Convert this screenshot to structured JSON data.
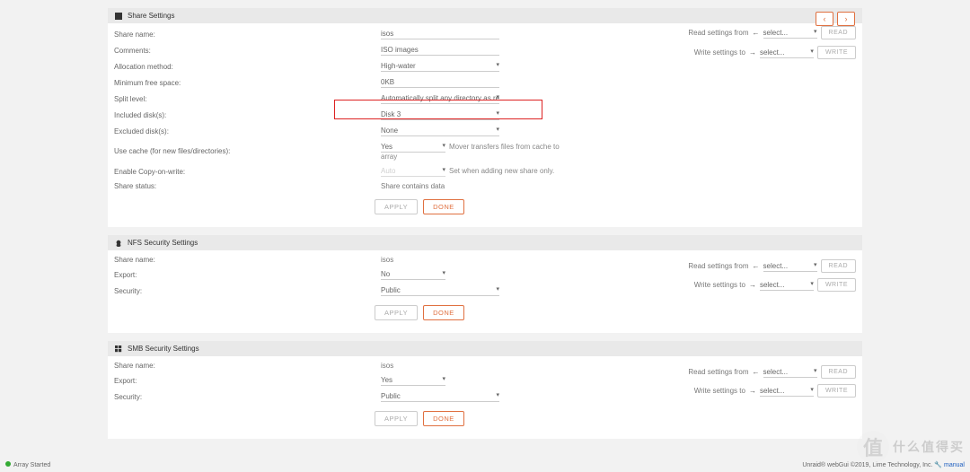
{
  "share": {
    "title": "Share Settings",
    "nav": {
      "prev": "‹",
      "next": "›"
    },
    "rows": {
      "name_label": "Share name:",
      "name_value": "isos",
      "comments_label": "Comments:",
      "comments_value": "ISO images",
      "alloc_label": "Allocation method:",
      "alloc_value": "High-water",
      "minfree_label": "Minimum free space:",
      "minfree_value": "0KB",
      "split_label": "Split level:",
      "split_value": "Automatically split any directory as required",
      "included_label": "Included disk(s):",
      "included_value": "Disk 3",
      "excluded_label": "Excluded disk(s):",
      "excluded_value": "None",
      "cache_label": "Use cache (for new files/directories):",
      "cache_value": "Yes",
      "cache_hint": "Mover transfers files from cache to array",
      "cow_label": "Enable Copy-on-write:",
      "cow_value": "Auto",
      "cow_hint": "Set when adding new share only.",
      "status_label": "Share status:",
      "status_value": "Share contains data"
    },
    "buttons": {
      "apply": "APPLY",
      "done": "DONE"
    },
    "rw": {
      "read_label": "Read settings from",
      "read_select": "select...",
      "read_btn": "READ",
      "write_label": "Write settings to",
      "write_select": "select...",
      "write_btn": "WRITE",
      "arrow_in": "←",
      "arrow_out": "→"
    }
  },
  "nfs": {
    "title": "NFS Security Settings",
    "rows": {
      "name_label": "Share name:",
      "name_value": "isos",
      "export_label": "Export:",
      "export_value": "No",
      "security_label": "Security:",
      "security_value": "Public"
    },
    "buttons": {
      "apply": "APPLY",
      "done": "DONE"
    }
  },
  "smb": {
    "title": "SMB Security Settings",
    "rows": {
      "name_label": "Share name:",
      "name_value": "isos",
      "export_label": "Export:",
      "export_value": "Yes",
      "security_label": "Security:",
      "security_value": "Public"
    },
    "buttons": {
      "apply": "APPLY",
      "done": "DONE"
    }
  },
  "footer": {
    "status": "Array Started",
    "credit": "Unraid® webGui ©2019, Lime Technology, Inc.",
    "manual": "manual"
  },
  "watermark": "什么值得买"
}
